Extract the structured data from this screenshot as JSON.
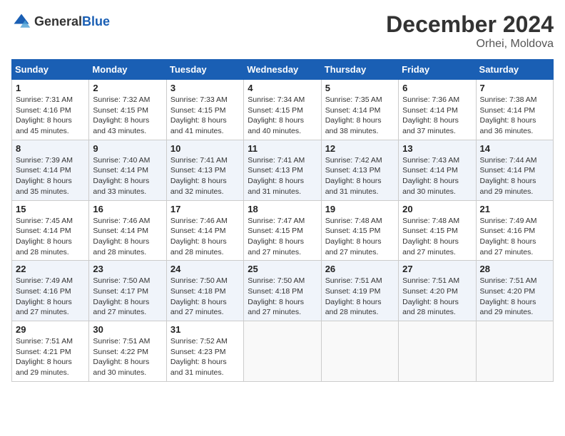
{
  "header": {
    "logo_general": "General",
    "logo_blue": "Blue",
    "month_title": "December 2024",
    "location": "Orhei, Moldova"
  },
  "weekdays": [
    "Sunday",
    "Monday",
    "Tuesday",
    "Wednesday",
    "Thursday",
    "Friday",
    "Saturday"
  ],
  "weeks": [
    [
      {
        "day": "1",
        "sunrise": "7:31 AM",
        "sunset": "4:16 PM",
        "daylight": "8 hours and 45 minutes."
      },
      {
        "day": "2",
        "sunrise": "7:32 AM",
        "sunset": "4:15 PM",
        "daylight": "8 hours and 43 minutes."
      },
      {
        "day": "3",
        "sunrise": "7:33 AM",
        "sunset": "4:15 PM",
        "daylight": "8 hours and 41 minutes."
      },
      {
        "day": "4",
        "sunrise": "7:34 AM",
        "sunset": "4:15 PM",
        "daylight": "8 hours and 40 minutes."
      },
      {
        "day": "5",
        "sunrise": "7:35 AM",
        "sunset": "4:14 PM",
        "daylight": "8 hours and 38 minutes."
      },
      {
        "day": "6",
        "sunrise": "7:36 AM",
        "sunset": "4:14 PM",
        "daylight": "8 hours and 37 minutes."
      },
      {
        "day": "7",
        "sunrise": "7:38 AM",
        "sunset": "4:14 PM",
        "daylight": "8 hours and 36 minutes."
      }
    ],
    [
      {
        "day": "8",
        "sunrise": "7:39 AM",
        "sunset": "4:14 PM",
        "daylight": "8 hours and 35 minutes."
      },
      {
        "day": "9",
        "sunrise": "7:40 AM",
        "sunset": "4:14 PM",
        "daylight": "8 hours and 33 minutes."
      },
      {
        "day": "10",
        "sunrise": "7:41 AM",
        "sunset": "4:13 PM",
        "daylight": "8 hours and 32 minutes."
      },
      {
        "day": "11",
        "sunrise": "7:41 AM",
        "sunset": "4:13 PM",
        "daylight": "8 hours and 31 minutes."
      },
      {
        "day": "12",
        "sunrise": "7:42 AM",
        "sunset": "4:13 PM",
        "daylight": "8 hours and 31 minutes."
      },
      {
        "day": "13",
        "sunrise": "7:43 AM",
        "sunset": "4:14 PM",
        "daylight": "8 hours and 30 minutes."
      },
      {
        "day": "14",
        "sunrise": "7:44 AM",
        "sunset": "4:14 PM",
        "daylight": "8 hours and 29 minutes."
      }
    ],
    [
      {
        "day": "15",
        "sunrise": "7:45 AM",
        "sunset": "4:14 PM",
        "daylight": "8 hours and 28 minutes."
      },
      {
        "day": "16",
        "sunrise": "7:46 AM",
        "sunset": "4:14 PM",
        "daylight": "8 hours and 28 minutes."
      },
      {
        "day": "17",
        "sunrise": "7:46 AM",
        "sunset": "4:14 PM",
        "daylight": "8 hours and 28 minutes."
      },
      {
        "day": "18",
        "sunrise": "7:47 AM",
        "sunset": "4:15 PM",
        "daylight": "8 hours and 27 minutes."
      },
      {
        "day": "19",
        "sunrise": "7:48 AM",
        "sunset": "4:15 PM",
        "daylight": "8 hours and 27 minutes."
      },
      {
        "day": "20",
        "sunrise": "7:48 AM",
        "sunset": "4:15 PM",
        "daylight": "8 hours and 27 minutes."
      },
      {
        "day": "21",
        "sunrise": "7:49 AM",
        "sunset": "4:16 PM",
        "daylight": "8 hours and 27 minutes."
      }
    ],
    [
      {
        "day": "22",
        "sunrise": "7:49 AM",
        "sunset": "4:16 PM",
        "daylight": "8 hours and 27 minutes."
      },
      {
        "day": "23",
        "sunrise": "7:50 AM",
        "sunset": "4:17 PM",
        "daylight": "8 hours and 27 minutes."
      },
      {
        "day": "24",
        "sunrise": "7:50 AM",
        "sunset": "4:18 PM",
        "daylight": "8 hours and 27 minutes."
      },
      {
        "day": "25",
        "sunrise": "7:50 AM",
        "sunset": "4:18 PM",
        "daylight": "8 hours and 27 minutes."
      },
      {
        "day": "26",
        "sunrise": "7:51 AM",
        "sunset": "4:19 PM",
        "daylight": "8 hours and 28 minutes."
      },
      {
        "day": "27",
        "sunrise": "7:51 AM",
        "sunset": "4:20 PM",
        "daylight": "8 hours and 28 minutes."
      },
      {
        "day": "28",
        "sunrise": "7:51 AM",
        "sunset": "4:20 PM",
        "daylight": "8 hours and 29 minutes."
      }
    ],
    [
      {
        "day": "29",
        "sunrise": "7:51 AM",
        "sunset": "4:21 PM",
        "daylight": "8 hours and 29 minutes."
      },
      {
        "day": "30",
        "sunrise": "7:51 AM",
        "sunset": "4:22 PM",
        "daylight": "8 hours and 30 minutes."
      },
      {
        "day": "31",
        "sunrise": "7:52 AM",
        "sunset": "4:23 PM",
        "daylight": "8 hours and 31 minutes."
      },
      null,
      null,
      null,
      null
    ]
  ]
}
